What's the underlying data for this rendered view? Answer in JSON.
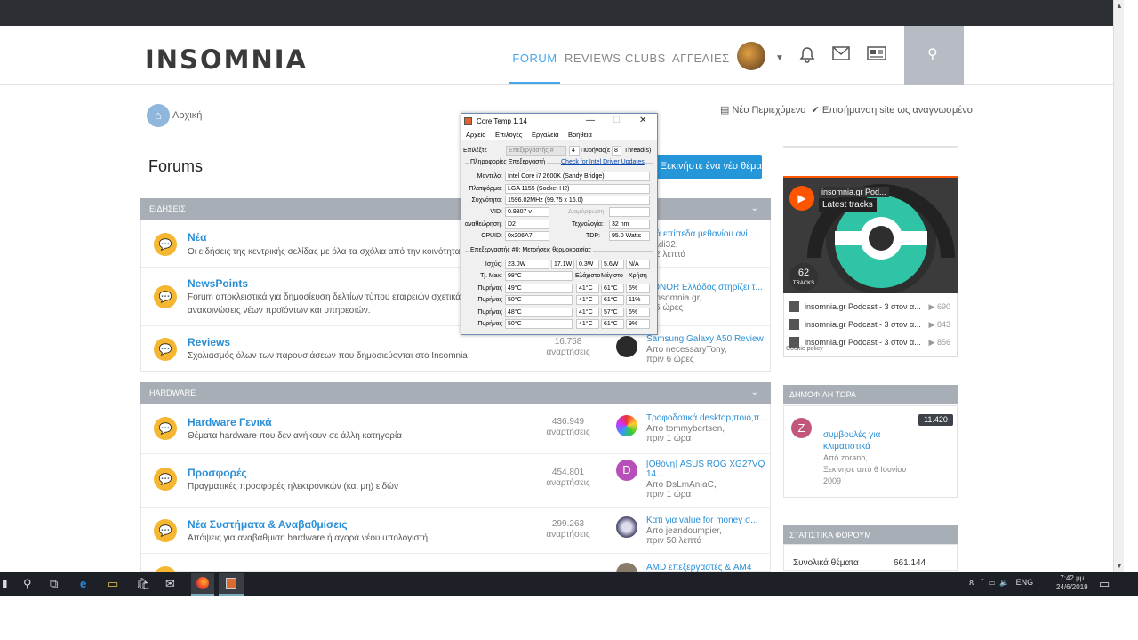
{
  "site": {
    "logo": "INSOMNIA",
    "nav": [
      {
        "label": "FORUM"
      },
      {
        "label": "REVIEWS"
      },
      {
        "label": "CLUBS"
      },
      {
        "label": "ΑΓΓΕΛΙΕΣ"
      }
    ],
    "breadcrumb": "Αρχική",
    "new_content": "Νέο Περιεχόμενο",
    "mark_read": "Επισήμανση site ως αναγνωσμένο",
    "page_title": "Forums",
    "new_thread": "Ξεκινήστε ένα νέο θέμα"
  },
  "categories": [
    {
      "name": "ΕΙΔΗΣΕΙΣ",
      "forums": [
        {
          "title": "Νέα",
          "desc": "Οι ειδήσεις της κεντρικής σελίδας με όλα τα σχόλια από την κοινότητα τ",
          "count": "",
          "count_label": "",
          "last_title": "ηλά επίπεδα μεθανίου ανί...",
          "last_by": "ο adi32,",
          "last_time": "ιν 2 λεπτά"
        },
        {
          "title": "NewsPoints",
          "desc": "Forum αποκλειστικά για δημοσίευση δελτίων τύπου εταιρειών σχετικά μ ανακοινώσεις νέων προϊόντων και υπηρεσιών.",
          "count": "",
          "count_label": "",
          "last_title": "HONOR Ελλάδος στηρίζει τ...",
          "last_by": "ο insomnia.gr,",
          "last_time": "ιν 6 ώρες"
        },
        {
          "title": "Reviews",
          "desc": "Σχολιασμός όλων των παρουσιάσεων που δημοσιεύονται στο Insomnia",
          "count": "16.758",
          "count_label": "αναρτήσεις",
          "last_title": "Samsung Galaxy A50 Review",
          "last_by": "Από necessaryTony,",
          "last_time": "πριν 6 ώρες"
        }
      ]
    },
    {
      "name": "HARDWARE",
      "forums": [
        {
          "title": "Hardware Γενικά",
          "desc": "Θέματα hardware που δεν ανήκουν σε άλλη κατηγορία",
          "count": "436.949",
          "count_label": "αναρτήσεις",
          "last_title": "Τροφοδοτικά desktop,ποιό,π...",
          "last_by": "Από tommybertsen,",
          "last_time": "πριν 1 ώρα"
        },
        {
          "title": "Προσφορές",
          "desc": "Πραγματικές προσφορές ηλεκτρονικών (και μη) ειδών",
          "count": "454.801",
          "count_label": "αναρτήσεις",
          "last_title": "[Οθόνη] ASUS ROG XG27VQ 14...",
          "last_by": "Από DsLmAnIaC,",
          "last_time": "πριν 1 ώρα"
        },
        {
          "title": "Νέα Συστήματα & Αναβαθμίσεις",
          "desc": "Απόψεις για αναβάθμιση hardware ή αγορά νέου υπολογιστή",
          "count": "299.263",
          "count_label": "αναρτήσεις",
          "last_title": "Κατι για value for money σ...",
          "last_by": "Από jeandoumpier,",
          "last_time": "πριν 50 λεπτά"
        },
        {
          "title": "",
          "desc": "",
          "count": "",
          "count_label": "",
          "last_title": "AMD επεξεργαστές & AM4",
          "last_by": "",
          "last_time": ""
        }
      ]
    }
  ],
  "sidebar": {
    "podcast_name": "insomnia.gr Pod...",
    "latest_tracks": "Latest tracks",
    "tracks_count": "62",
    "tracks_label": "TRACKS",
    "tracks": [
      {
        "title": "insomnia.gr Podcast - 3 στον α...",
        "plays": "690"
      },
      {
        "title": "insomnia.gr Podcast - 3 στον α...",
        "plays": "843"
      },
      {
        "title": "insomnia.gr Podcast - 3 στον α...",
        "plays": "856"
      }
    ],
    "cookie": "Cookie policy",
    "popular_head": "ΔΗΜΟΦΙΛΗ ΤΩΡΑ",
    "popular": {
      "avatar": "Z",
      "badge": "11.420",
      "title": "συμβουλές για κλιματιστικά",
      "by": "Από zoranb,",
      "started": "Ξεκίνησε από 6 Ιουνίου 2009"
    },
    "stats_head": "ΣΤΑΤΙΣΤΙΚΑ ΦΟΡΟΥΜ",
    "stats_label": "Συνολικά θέματα",
    "stats_value": "661.144"
  },
  "coretemp": {
    "title": "Core Temp 1.14",
    "menu": [
      "Αρχείο",
      "Επιλογές",
      "Εργαλεία",
      "Βοήθεια"
    ],
    "select_label": "Επιλέξτε",
    "select_value": "Επεξεργαστής #",
    "select_num": "4",
    "cores_label": "Πυρήνας(ε",
    "threads_num": "8",
    "threads_label": "Thread(s)",
    "info_label": "Πληροφορίες Επεξεργαστή",
    "driver_link": "Check for Intel Driver Updates",
    "model_label": "Μοντέλο:",
    "model": "Intel Core i7 2600K (Sandy Bridge)",
    "platform_label": "Πλατφόρμα:",
    "platform": "LGA 1155 (Socket H2)",
    "freq_label": "Συχνότητα:",
    "freq": "1596.02MHz (99.75 x 16.0)",
    "vid_label": "VID:",
    "vid": "0.9807 v",
    "mod_label": "Διαμόρφωση:",
    "rev_label": "αναθεώρηση:",
    "rev": "D2",
    "tech_label": "Τεχνολογία:",
    "tech": "32 nm",
    "cpuid_label": "CPUID:",
    "cpuid": "0x206A7",
    "tdp_label": "TDP:",
    "tdp": "95.0 Watts",
    "temp_head": "Επεξεργαστής #0: Μετρήσεις θερμοκρασίας",
    "power_label": "Ισχύς:",
    "power": [
      "23.0W",
      "17.1W",
      "0.3W",
      "5.6W",
      "N/A"
    ],
    "tjmax_label": "Tj. Max:",
    "tjmax": "98°C",
    "col_min": "Ελάχιστο",
    "col_max": "Μέγιστο",
    "col_load": "Χρήση",
    "cores": [
      {
        "label": "Πυρήνας",
        "temp": "49°C",
        "min": "41°C",
        "max": "61°C",
        "load": "6%"
      },
      {
        "label": "Πυρήνας",
        "temp": "50°C",
        "min": "41°C",
        "max": "61°C",
        "load": "11%"
      },
      {
        "label": "Πυρήνας",
        "temp": "48°C",
        "min": "41°C",
        "max": "57°C",
        "load": "6%"
      },
      {
        "label": "Πυρήνας",
        "temp": "50°C",
        "min": "41°C",
        "max": "61°C",
        "load": "9%"
      }
    ]
  },
  "taskbar": {
    "lang": "ENG",
    "time": "7:42 μμ",
    "date": "24/6/2019"
  },
  "colors": {
    "accent": "#47a7eb",
    "forum_icon": "#f5b731",
    "link": "#2a8fd6",
    "podcast": "#ff5500"
  }
}
